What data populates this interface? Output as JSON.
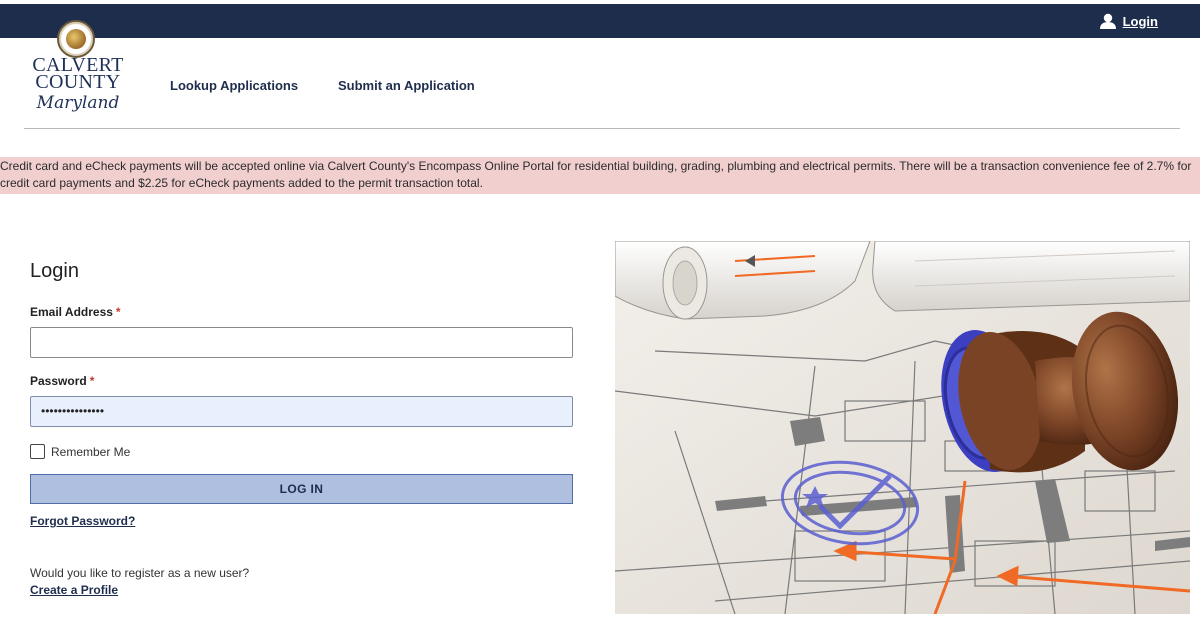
{
  "topbar": {
    "login_label": "Login",
    "login_icon": "user-icon"
  },
  "header": {
    "logo": {
      "line1": "CALVERT",
      "line2": "COUNTY",
      "line3": "Maryland"
    },
    "nav": [
      {
        "label": "Lookup Applications"
      },
      {
        "label": "Submit an Application"
      }
    ]
  },
  "banner": {
    "text": "Credit card and eCheck payments will be accepted online via Calvert County's Encompass Online Portal for residential building, grading, plumbing and electrical permits. There will be a transaction convenience fee of 2.7% for credit card payments and $2.25 for eCheck payments added to the permit transaction total."
  },
  "login": {
    "title": "Login",
    "email_label": "Email Address",
    "email_value": "",
    "required_mark": "*",
    "password_label": "Password",
    "password_value": "•••••••••••••••",
    "remember_label": "Remember Me",
    "remember_checked": false,
    "submit_label": "LOG IN",
    "forgot_label": "Forgot Password?",
    "register_prompt": "Would you like to register as a new user?",
    "create_label": "Create a Profile"
  },
  "colors": {
    "topbar": "#1f2d4d",
    "banner": "#f2cfcf",
    "button": "#aebfe0",
    "stamp_handle": "#6b3b22",
    "stamp_face": "#4a4fc8",
    "plan_arrow": "#f06a25"
  }
}
